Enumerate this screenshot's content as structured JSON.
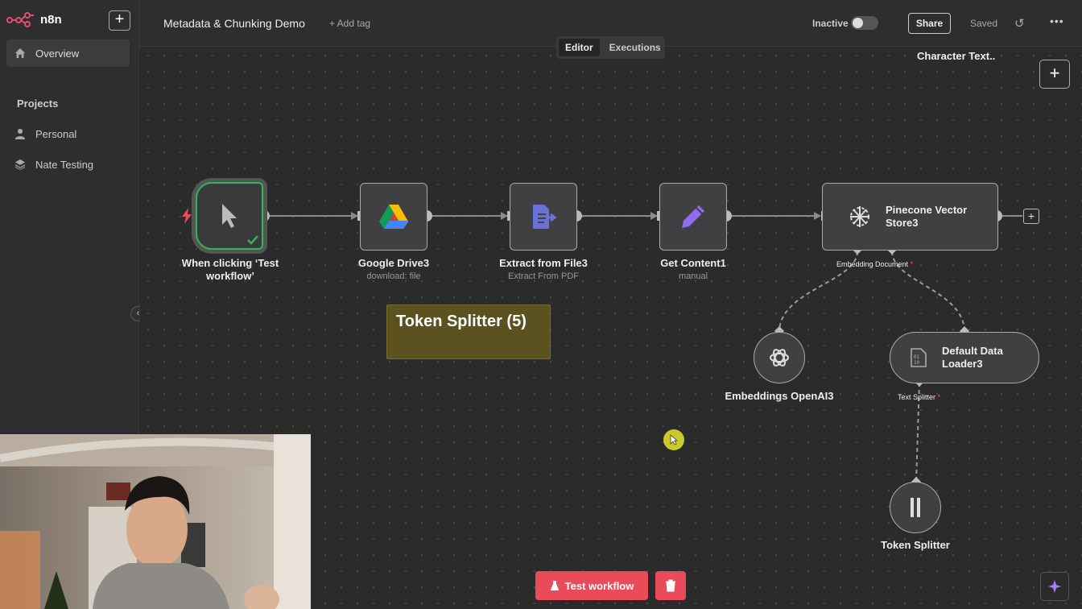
{
  "app": {
    "name": "n8n"
  },
  "sidebar": {
    "add_label": "+",
    "overview": "Overview",
    "projects_heading": "Projects",
    "items": [
      {
        "label": "Personal"
      },
      {
        "label": "Nate Testing"
      }
    ]
  },
  "header": {
    "title": "Metadata & Chunking Demo",
    "add_tag": "+ Add tag",
    "status": "Inactive",
    "share": "Share",
    "saved": "Saved",
    "tabs": [
      {
        "label": "Editor"
      },
      {
        "label": "Executions"
      }
    ]
  },
  "canvas": {
    "overlay_text": "Character Text..",
    "sticky_note": "Token Splitter (5)",
    "nodes": [
      {
        "label": "When clicking ‘Test workflow’",
        "sub": ""
      },
      {
        "label": "Google Drive3",
        "sub": "download: file"
      },
      {
        "label": "Extract from File3",
        "sub": "Extract From PDF"
      },
      {
        "label": "Get Content1",
        "sub": "manual"
      },
      {
        "label": "Pinecone Vector Store3",
        "sub": ""
      }
    ],
    "pinecone_ports": {
      "label": "Embedding Document",
      "required": "*"
    },
    "embeddings": {
      "label": "Embeddings OpenAI3"
    },
    "loader": {
      "label": "Default Data Loader3",
      "port": "Text Splitter",
      "required": "*"
    },
    "splitter": {
      "label": "Token Splitter"
    }
  },
  "footer": {
    "test_button": "Test workflow"
  },
  "colors": {
    "accent": "#ea4b5a",
    "success": "#31b45a",
    "sticky": "#5b5220"
  }
}
